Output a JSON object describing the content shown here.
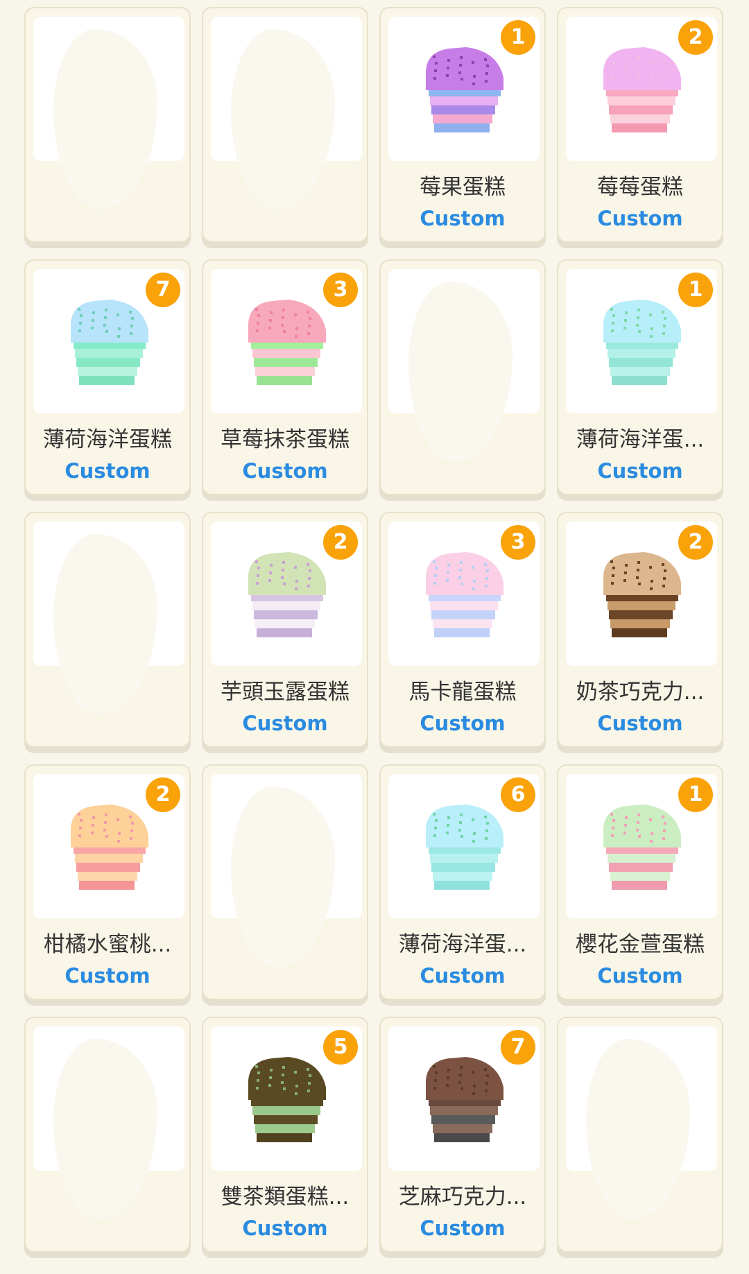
{
  "tag_label": "Custom",
  "cells": [
    {
      "id": 0,
      "blank": true
    },
    {
      "id": 1,
      "blank": true
    },
    {
      "id": 2,
      "name": "莓果蛋糕",
      "count": "1",
      "colors": {
        "top": "#c77de7",
        "spr": "#8e3fb8",
        "layers": [
          "#8eb6f0",
          "#e7b0f0",
          "#a98ae8",
          "#f4a9d0",
          "#8fb0ee"
        ]
      }
    },
    {
      "id": 3,
      "name": "莓莓蛋糕",
      "count": "2",
      "colors": {
        "top": "#f2b4f0",
        "spr": "#f0bde8",
        "layers": [
          "#f8a8c0",
          "#fbd0dc",
          "#f6a2b8",
          "#fbd1dd",
          "#f49ab0"
        ]
      }
    },
    {
      "id": 4,
      "name": "薄荷海洋蛋糕",
      "count": "7",
      "colors": {
        "top": "#b7e3fb",
        "spr": "#6fd0b8",
        "layers": [
          "#84ecc9",
          "#a9f0d8",
          "#87e9c4",
          "#b6f3dd",
          "#7fe1bd"
        ]
      }
    },
    {
      "id": 5,
      "name": "草莓抹茶蛋糕",
      "count": "3",
      "colors": {
        "top": "#f7a8ba",
        "spr": "#f07fa0",
        "layers": [
          "#a3ef9b",
          "#fbc5d1",
          "#9fe89a",
          "#fad0d9",
          "#99e293"
        ]
      }
    },
    {
      "id": 6,
      "blank": true
    },
    {
      "id": 7,
      "name": "薄荷海洋蛋...",
      "count": "1",
      "colors": {
        "top": "#b6eefa",
        "spr": "#7fd9a8",
        "layers": [
          "#9be9dc",
          "#b3f0e7",
          "#93e5d6",
          "#b8f2ea",
          "#8de0d0"
        ]
      }
    },
    {
      "id": 8,
      "blank": true
    },
    {
      "id": 9,
      "name": "芋頭玉露蛋糕",
      "count": "2",
      "colors": {
        "top": "#d2e3b6",
        "spr": "#c9a2cf",
        "layers": [
          "#d7c4e3",
          "#f3ecf5",
          "#ccb7dd",
          "#f5eef7",
          "#c6afd8"
        ]
      }
    },
    {
      "id": 10,
      "name": "馬卡龍蛋糕",
      "count": "3",
      "colors": {
        "top": "#fbd0e6",
        "spr": "#b9cdf5",
        "layers": [
          "#c9d6fb",
          "#fbe0ee",
          "#c4d3fa",
          "#fbe3f0",
          "#bfd0f8"
        ]
      }
    },
    {
      "id": 11,
      "name": "奶茶巧克力...",
      "count": "2",
      "colors": {
        "top": "#dcb68c",
        "spr": "#6a4224",
        "layers": [
          "#6b4426",
          "#c99c6c",
          "#6d4527",
          "#c89a69",
          "#5e3a1f"
        ]
      }
    },
    {
      "id": 12,
      "name": "柑橘水蜜桃...",
      "count": "2",
      "colors": {
        "top": "#fdd198",
        "spr": "#f29aa6",
        "layers": [
          "#f9a6a6",
          "#fdd3a6",
          "#f89d9d",
          "#fcd7ab",
          "#f49696"
        ]
      }
    },
    {
      "id": 13,
      "blank": true
    },
    {
      "id": 14,
      "name": "薄荷海洋蛋...",
      "count": "6",
      "colors": {
        "top": "#b9eefb",
        "spr": "#6fd6a5",
        "layers": [
          "#9de8e7",
          "#b6f1f0",
          "#97e6e3",
          "#baf3f1",
          "#8fe1dd"
        ]
      }
    },
    {
      "id": 15,
      "name": "櫻花金萱蛋糕",
      "count": "1",
      "colors": {
        "top": "#cbedc2",
        "spr": "#f2a2b8",
        "layers": [
          "#f4a8b8",
          "#d6f0cf",
          "#f2a0b2",
          "#d9f2d2",
          "#f09aad"
        ]
      }
    },
    {
      "id": 16,
      "blank": true
    },
    {
      "id": 17,
      "name": "雙茶類蛋糕...",
      "count": "5",
      "colors": {
        "top": "#5a4a23",
        "spr": "#86b27a",
        "layers": [
          "#5b4b24",
          "#99c88a",
          "#5d4d26",
          "#9ccb8d",
          "#51421f"
        ]
      }
    },
    {
      "id": 18,
      "name": "芝麻巧克力...",
      "count": "7",
      "colors": {
        "top": "#7c5242",
        "spr": "#5a3a2e",
        "layers": [
          "#6a4a3e",
          "#8a6a5a",
          "#5a5a5a",
          "#8b6b5b",
          "#4a4a4a"
        ]
      }
    },
    {
      "id": 19,
      "blank": true
    }
  ]
}
